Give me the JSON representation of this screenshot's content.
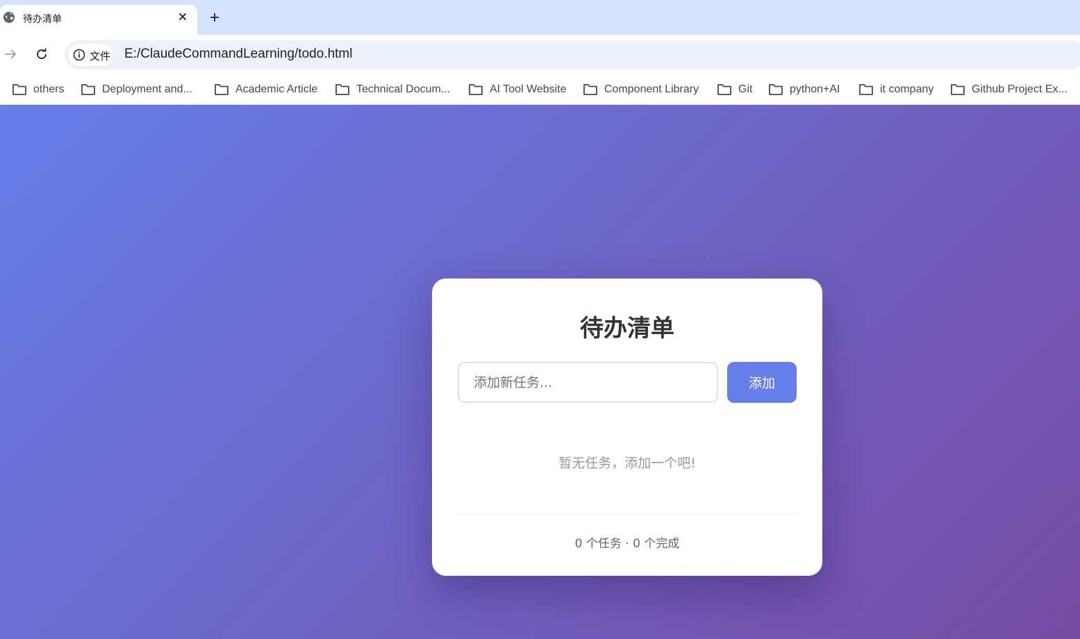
{
  "tab": {
    "title": "待办清单",
    "close_glyph": "✕"
  },
  "newtab_glyph": "+",
  "toolbar": {
    "forward_icon": "arrow-right-icon",
    "reload_icon": "reload-icon",
    "security_chip_label": "文件",
    "url": "E:/ClaudeCommandLearning/todo.html"
  },
  "bookmarks": [
    {
      "label": "others"
    },
    {
      "label": "Deployment and..."
    },
    {
      "label": "Academic Article"
    },
    {
      "label": "Technical Docum..."
    },
    {
      "label": "AI Tool Website"
    },
    {
      "label": "Component Library"
    },
    {
      "label": "Git"
    },
    {
      "label": "python+AI"
    },
    {
      "label": "it company"
    },
    {
      "label": "Github Project Ex..."
    }
  ],
  "todo": {
    "title": "待办清单",
    "input_placeholder": "添加新任务...",
    "input_value": "",
    "add_label": "添加",
    "empty_message": "暂无任务，添加一个吧!",
    "stats": "0 个任务 · 0 个完成"
  },
  "colors": {
    "gradient_start": "#667eea",
    "gradient_end": "#764ba2",
    "accent": "#667eea",
    "tabstrip": "#d3e3fd"
  }
}
